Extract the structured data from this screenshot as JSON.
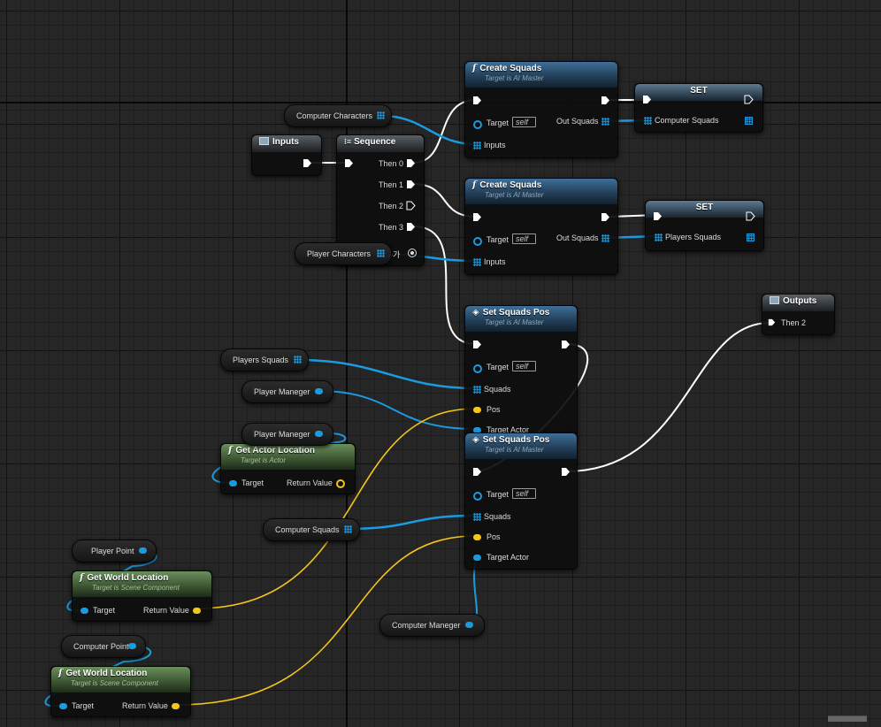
{
  "colors": {
    "exec": "#ffffff",
    "object": "#1a9be0",
    "vector": "#f5c518",
    "function_header": "#2f5a7c",
    "pure_header": "#557a47",
    "background": "#262626"
  },
  "inputs_node": {
    "title": "Inputs",
    "icon": "entry-icon"
  },
  "outputs_node": {
    "title": "Outputs",
    "icon": "exit-icon",
    "pin": "Then 2"
  },
  "sequence_node": {
    "title": "Sequence",
    "pins": [
      "Then 0",
      "Then 1",
      "Then 2",
      "Then 3"
    ],
    "add_pin": "핀 추가"
  },
  "create_squads_1": {
    "title": "Create Squads",
    "subtitle": "Target is AI Master",
    "target": "Target",
    "self": "self",
    "inputs": "Inputs",
    "out": "Out Squads"
  },
  "create_squads_2": {
    "title": "Create Squads",
    "subtitle": "Target is AI Master",
    "target": "Target",
    "self": "self",
    "inputs": "Inputs",
    "out": "Out Squads"
  },
  "set_1": {
    "title": "SET",
    "var": "Computer Squads"
  },
  "set_2": {
    "title": "SET",
    "var": "Players Squads"
  },
  "set_squads_pos_1": {
    "title": "Set Squads Pos",
    "subtitle": "Target is AI Master",
    "target": "Target",
    "self": "self",
    "squads": "Squads",
    "pos": "Pos",
    "target_actor": "Target Actor"
  },
  "set_squads_pos_2": {
    "title": "Set Squads Pos",
    "subtitle": "Target is AI Master",
    "target": "Target",
    "self": "self",
    "squads": "Squads",
    "pos": "Pos",
    "target_actor": "Target Actor"
  },
  "get_actor_location": {
    "title": "Get Actor Location",
    "subtitle": "Target is Actor",
    "target": "Target",
    "ret": "Return Value"
  },
  "get_world_location_1": {
    "title": "Get World Location",
    "subtitle": "Target is Scene Component",
    "target": "Target",
    "ret": "Return Value"
  },
  "get_world_location_2": {
    "title": "Get World Location",
    "subtitle": "Target is Scene Component",
    "target": "Target",
    "ret": "Return Value"
  },
  "getters": {
    "computer_characters": "Computer Characters",
    "player_characters": "Player Characters",
    "players_squads": "Players Squads",
    "player_maneger_1": "Player Maneger",
    "player_maneger_2": "Player Maneger",
    "computer_squads": "Computer Squads",
    "player_point": "Player Point",
    "computer_point": "Computer Point",
    "computer_maneger": "Computer Maneger"
  }
}
